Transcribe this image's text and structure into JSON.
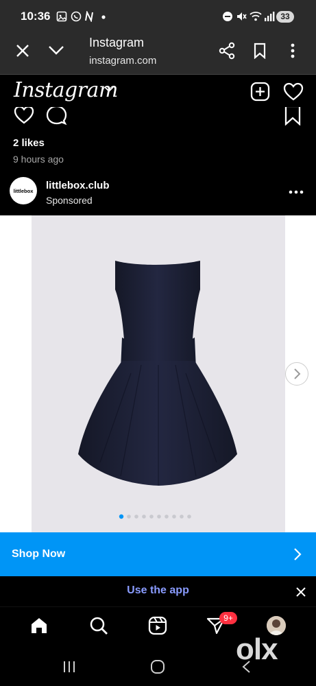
{
  "status_bar": {
    "time": "10:36",
    "battery": "33"
  },
  "browser": {
    "title": "Instagram",
    "url": "instagram.com"
  },
  "instagram": {
    "logo": "Instagram",
    "likes": "2 likes",
    "time_ago": "9 hours ago",
    "account": {
      "avatar_text": "littlebox",
      "username": "littlebox.club",
      "sponsored": "Sponsored"
    },
    "carousel": {
      "current_index": 1,
      "total_slides": 10
    },
    "cta_label": "Shop Now",
    "use_app_label": "Use the app",
    "nav": {
      "notification_badge": "9+"
    }
  },
  "watermark": "olx",
  "colors": {
    "accent": "#0095f6",
    "badge": "#ff3040",
    "dress": "#1c1f33"
  }
}
